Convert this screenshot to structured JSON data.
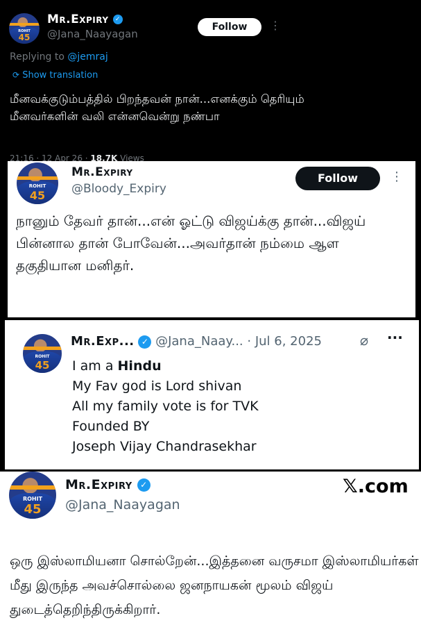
{
  "tweet1": {
    "name": "Mr.Expiry",
    "handle": "@Jana_Naayagan",
    "follow": "Follow",
    "replying_prefix": "Replying to ",
    "replying_to": "@jemraj",
    "show_translation": "Show translation",
    "body": "மீனவக்குடும்பத்தில் பிறந்தவன் நான்...எனக்கும் தெரியும் மீனவர்களின் வலி என்னவென்று நண்பா",
    "time": "21:16 · 12 Apr 26 · ",
    "views": "18.7K",
    "views_suffix": " Views"
  },
  "tweet2": {
    "name": "Mr.Expiry",
    "handle": "@Bloody_Expiry",
    "follow": "Follow",
    "body": "நானும் தேவர் தான்...என் ஓட்டு விஜய்க்கு தான்...விஜய் பின்னால தான் போவேன்...அவர்தான் நம்மை ஆள தகுதியான மனிதர்."
  },
  "tweet3": {
    "name": "Mr.Exp...",
    "handle": "@Jana_Naay...",
    "date": "· Jul 6, 2025",
    "lines": [
      {
        "pre": "I am a ",
        "bold": "Hindu"
      },
      {
        "pre": "My Fav god is Lord shivan",
        "bold": ""
      },
      {
        "pre": "All my family vote is for TVK",
        "bold": ""
      },
      {
        "pre": "Founded BY",
        "bold": ""
      },
      {
        "pre": "Joseph Vijay Chandrasekhar",
        "bold": ""
      }
    ]
  },
  "tweet4": {
    "name": "Mr.Expiry",
    "handle": "@Jana_Naayagan",
    "watermark": "𝕏.com",
    "body": "ஒரு இஸ்லாமியனா சொல்றேன்...இத்தனை வருசமா இஸ்லாமியர்கள் மீது இருந்த அவச்சொல்லை ஜனநாயகன் மூலம் விஜய் துடைத்தெறிந்திருக்கிறார்."
  },
  "avatar": {
    "jersey_name": "ROHIT",
    "jersey_number": "45"
  },
  "colors": {
    "accent": "#1d9bf0",
    "dark_bg": "#000000",
    "muted": "#71767b"
  },
  "icons": [
    "verified-badge-icon",
    "more-options-icon",
    "translate-icon",
    "grok-icon"
  ]
}
